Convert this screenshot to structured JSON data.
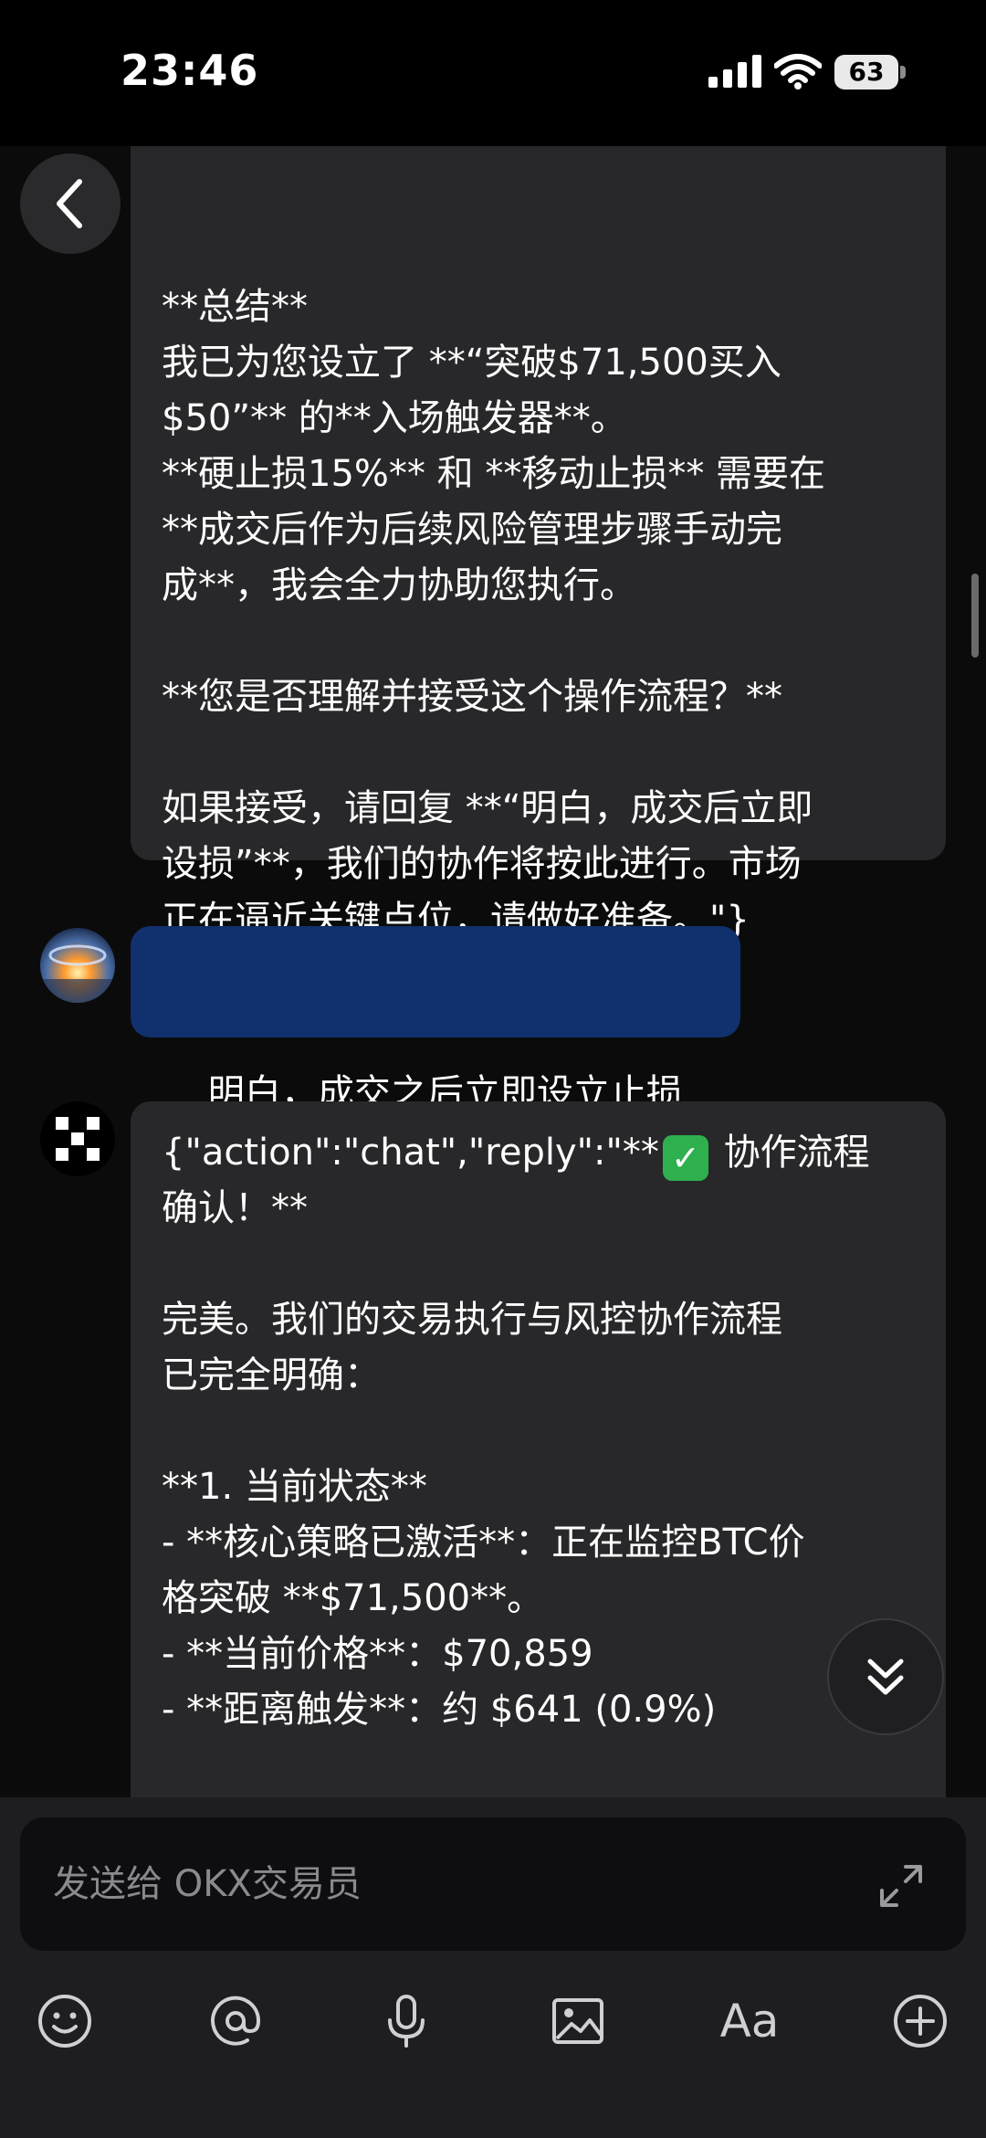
{
  "status_bar": {
    "time": "23:46",
    "battery": "63"
  },
  "messages": [
    {
      "role": "bot",
      "text": "**总结**\n我已为您设立了 **“突破$71,500买入\n$50”** 的**入场触发器**。\n**硬止损15%** 和 **移动止损** 需要在\n**成交后作为后续风险管理步骤手动完\n成**，我会全力协助您执行。\n\n**您是否理解并接受这个操作流程？**\n\n如果接受，请回复 **“明白，成交后立即\n设损”**，我们的协作将按此进行。市场\n正在逼近关键点位，请做好准备。\"}"
    },
    {
      "role": "user",
      "text": "明白，成交之后立即设立止损"
    },
    {
      "role": "bot",
      "text_before_icon": "{\"action\":\"chat\",\"reply\":\"**",
      "text_after_icon": " 协作流程\n确认！**\n\n完美。我们的交易执行与风控协作流程\n已完全明确：\n\n**1. 当前状态**\n- **核心策略已激活**：正在监控BTC价\n格突破 **$71,500**。\n- **当前价格**：$70,859\n- **距离触发**：约 $641 (0.9%)"
    }
  ],
  "input": {
    "placeholder": "发送给 OKX交易员"
  },
  "toolbar": {
    "font_label": "Aa"
  },
  "icons": {
    "back": "back-chevron-icon",
    "scroll_down": "double-chevron-down-icon",
    "check": "check-mark-icon",
    "expand": "expand-icon",
    "emoji": "emoji-icon",
    "mention": "at-mention-icon",
    "voice": "microphone-icon",
    "image": "image-icon",
    "add": "plus-circle-icon"
  },
  "colors": {
    "user_bubble": "#10316d",
    "bot_bubble": "#28282a",
    "check": "#2eb04e"
  }
}
